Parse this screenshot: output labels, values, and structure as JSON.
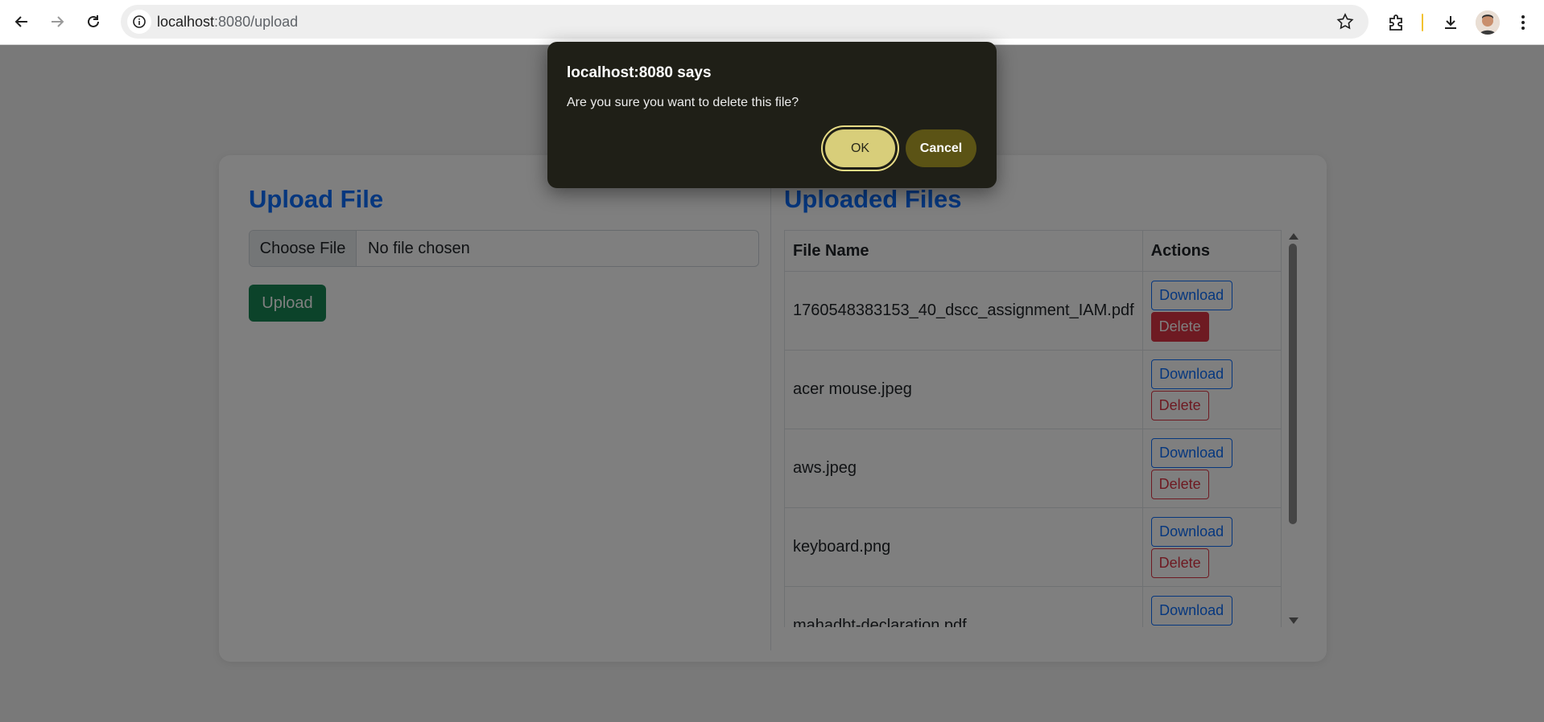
{
  "browser": {
    "url_host": "localhost",
    "url_path": ":8080/upload"
  },
  "page": {
    "upload_title": "Upload File",
    "choose_file_label": "Choose File",
    "no_file_text": "No file chosen",
    "upload_button": "Upload",
    "files_title": "Uploaded Files",
    "table": {
      "headers": [
        "File Name",
        "Actions"
      ],
      "download_label": "Download",
      "delete_label": "Delete",
      "rows": [
        {
          "name": "1760548383153_40_dscc_assignment_IAM.pdf"
        },
        {
          "name": "acer mouse.jpeg"
        },
        {
          "name": "aws.jpeg"
        },
        {
          "name": "keyboard.png"
        },
        {
          "name": "mahadbt-declaration.pdf"
        }
      ]
    }
  },
  "dialog": {
    "title": "localhost:8080 says",
    "message": "Are you sure you want to delete this file?",
    "ok_label": "OK",
    "cancel_label": "Cancel"
  },
  "colors": {
    "primary": "#0d6efd",
    "success": "#198754",
    "danger": "#dc3545",
    "dialog_bg": "#1f1f17",
    "ok_button": "#d8ce7a",
    "cancel_button": "#5b5315"
  },
  "icons": [
    "back-arrow-icon",
    "forward-arrow-icon",
    "reload-icon",
    "info-icon",
    "star-icon",
    "extensions-icon",
    "download-icon",
    "profile-avatar",
    "more-vert-icon"
  ]
}
